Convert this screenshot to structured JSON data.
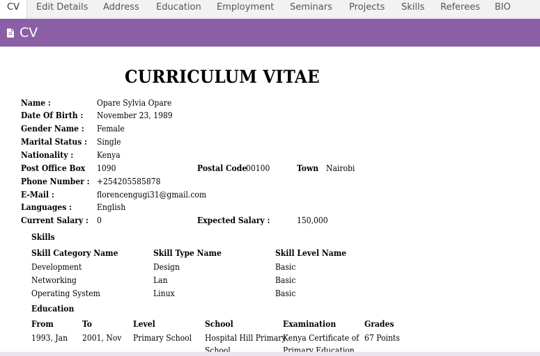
{
  "tabs": [
    "CV",
    "Edit Details",
    "Address",
    "Education",
    "Employment",
    "Seminars",
    "Projects",
    "Skills",
    "Referees",
    "BIO"
  ],
  "header": {
    "title": "CV",
    "icon": "document-icon"
  },
  "cv_title": "CURRICULUM VITAE",
  "personal": {
    "name_label": "Name :",
    "name": "Opare Sylvia Opare",
    "dob_label": "Date Of Birth :",
    "dob": "November 23, 1989",
    "gender_label": "Gender Name :",
    "gender": "Female",
    "marital_label": "Marital Status :",
    "marital": "Single",
    "nationality_label": "Nationality :",
    "nationality": "Kenya",
    "pobox_label": "Post Office Box",
    "pobox": "1090",
    "postal_label": "Postal Code",
    "postal": "00100",
    "town_label": "Town",
    "town": "Nairobi",
    "phone_label": "Phone Number :",
    "phone": "+254205585878",
    "email_label": "E-Mail :",
    "email": "florencengugi31@gmail.com",
    "languages_label": "Languages :",
    "languages": "English",
    "current_salary_label": "Current Salary :",
    "current_salary": "0",
    "expected_salary_label": "Expected Salary :",
    "expected_salary": "150,000"
  },
  "skills": {
    "heading": "Skills",
    "columns": [
      "Skill Category Name",
      "Skill Type Name",
      "Skill Level Name"
    ],
    "rows": [
      [
        "Development",
        "Design",
        "Basic"
      ],
      [
        "Networking",
        "Lan",
        "Basic"
      ],
      [
        "Operating System",
        "Linux",
        "Basic"
      ]
    ]
  },
  "education": {
    "heading": "Education",
    "columns": [
      "From",
      "To",
      "Level",
      "School",
      "Examination",
      "Grades"
    ],
    "rows": [
      [
        "1993, Jan",
        "2001, Nov",
        "Primary School",
        "Hospital Hill Primary School",
        "Kenya Certificate of Primary Education",
        "67 Points"
      ]
    ],
    "school_line1": "Hospital Hill Primary",
    "school_line2": "School",
    "exam_line1": "Kenya Certificate of",
    "exam_line2": "Primary Education"
  }
}
